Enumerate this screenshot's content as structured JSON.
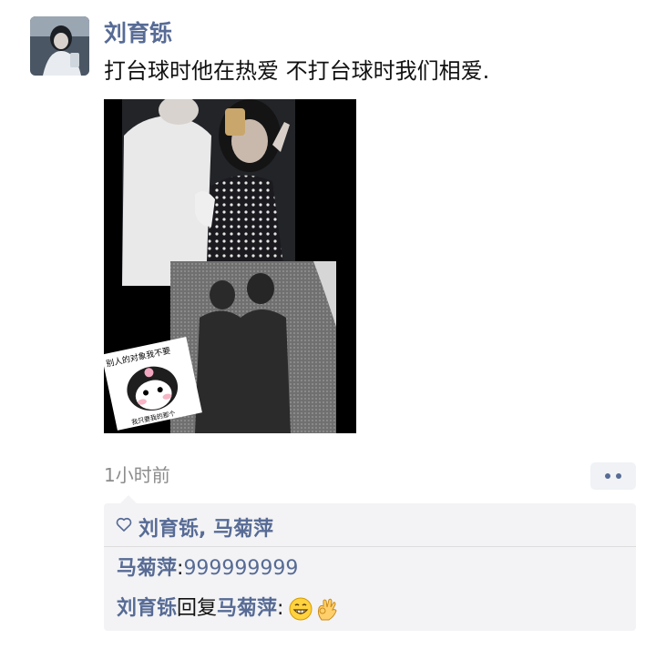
{
  "post": {
    "author": "刘育铄",
    "text": "打台球时他在热爱 不打台球时我们相爱.",
    "timestamp": "1小时前"
  },
  "likes": {
    "names": "刘育铄, 马菊萍"
  },
  "comments": [
    {
      "author": "马菊萍",
      "separator": ": ",
      "text": "999999999"
    },
    {
      "author": "刘育铄",
      "reply_word": "回复",
      "reply_to": "马菊萍",
      "separator": ": ",
      "emojis": [
        "grin-emoji",
        "ok-hand-emoji"
      ]
    }
  ],
  "sticker_text": {
    "top": "别人的对象我不要",
    "bottom": "我只要我的那个"
  },
  "colors": {
    "link": "#576b95",
    "text": "#111111",
    "muted": "#8c8c8c",
    "panel": "#f3f3f5"
  }
}
